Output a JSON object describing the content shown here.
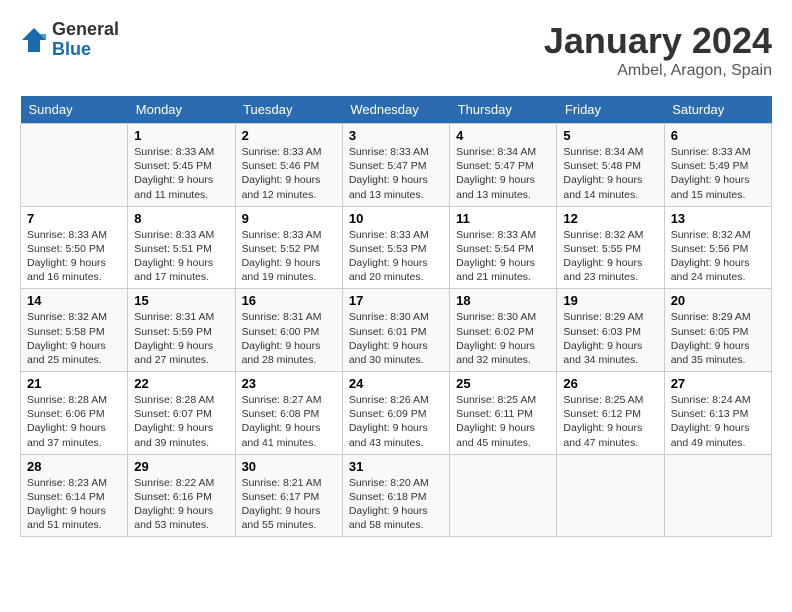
{
  "logo": {
    "general": "General",
    "blue": "Blue"
  },
  "title": "January 2024",
  "location": "Ambel, Aragon, Spain",
  "headers": [
    "Sunday",
    "Monday",
    "Tuesday",
    "Wednesday",
    "Thursday",
    "Friday",
    "Saturday"
  ],
  "weeks": [
    [
      {
        "day": "",
        "sunrise": "",
        "sunset": "",
        "daylight": ""
      },
      {
        "day": "1",
        "sunrise": "Sunrise: 8:33 AM",
        "sunset": "Sunset: 5:45 PM",
        "daylight": "Daylight: 9 hours and 11 minutes."
      },
      {
        "day": "2",
        "sunrise": "Sunrise: 8:33 AM",
        "sunset": "Sunset: 5:46 PM",
        "daylight": "Daylight: 9 hours and 12 minutes."
      },
      {
        "day": "3",
        "sunrise": "Sunrise: 8:33 AM",
        "sunset": "Sunset: 5:47 PM",
        "daylight": "Daylight: 9 hours and 13 minutes."
      },
      {
        "day": "4",
        "sunrise": "Sunrise: 8:34 AM",
        "sunset": "Sunset: 5:47 PM",
        "daylight": "Daylight: 9 hours and 13 minutes."
      },
      {
        "day": "5",
        "sunrise": "Sunrise: 8:34 AM",
        "sunset": "Sunset: 5:48 PM",
        "daylight": "Daylight: 9 hours and 14 minutes."
      },
      {
        "day": "6",
        "sunrise": "Sunrise: 8:33 AM",
        "sunset": "Sunset: 5:49 PM",
        "daylight": "Daylight: 9 hours and 15 minutes."
      }
    ],
    [
      {
        "day": "7",
        "sunrise": "Sunrise: 8:33 AM",
        "sunset": "Sunset: 5:50 PM",
        "daylight": "Daylight: 9 hours and 16 minutes."
      },
      {
        "day": "8",
        "sunrise": "Sunrise: 8:33 AM",
        "sunset": "Sunset: 5:51 PM",
        "daylight": "Daylight: 9 hours and 17 minutes."
      },
      {
        "day": "9",
        "sunrise": "Sunrise: 8:33 AM",
        "sunset": "Sunset: 5:52 PM",
        "daylight": "Daylight: 9 hours and 19 minutes."
      },
      {
        "day": "10",
        "sunrise": "Sunrise: 8:33 AM",
        "sunset": "Sunset: 5:53 PM",
        "daylight": "Daylight: 9 hours and 20 minutes."
      },
      {
        "day": "11",
        "sunrise": "Sunrise: 8:33 AM",
        "sunset": "Sunset: 5:54 PM",
        "daylight": "Daylight: 9 hours and 21 minutes."
      },
      {
        "day": "12",
        "sunrise": "Sunrise: 8:32 AM",
        "sunset": "Sunset: 5:55 PM",
        "daylight": "Daylight: 9 hours and 23 minutes."
      },
      {
        "day": "13",
        "sunrise": "Sunrise: 8:32 AM",
        "sunset": "Sunset: 5:56 PM",
        "daylight": "Daylight: 9 hours and 24 minutes."
      }
    ],
    [
      {
        "day": "14",
        "sunrise": "Sunrise: 8:32 AM",
        "sunset": "Sunset: 5:58 PM",
        "daylight": "Daylight: 9 hours and 25 minutes."
      },
      {
        "day": "15",
        "sunrise": "Sunrise: 8:31 AM",
        "sunset": "Sunset: 5:59 PM",
        "daylight": "Daylight: 9 hours and 27 minutes."
      },
      {
        "day": "16",
        "sunrise": "Sunrise: 8:31 AM",
        "sunset": "Sunset: 6:00 PM",
        "daylight": "Daylight: 9 hours and 28 minutes."
      },
      {
        "day": "17",
        "sunrise": "Sunrise: 8:30 AM",
        "sunset": "Sunset: 6:01 PM",
        "daylight": "Daylight: 9 hours and 30 minutes."
      },
      {
        "day": "18",
        "sunrise": "Sunrise: 8:30 AM",
        "sunset": "Sunset: 6:02 PM",
        "daylight": "Daylight: 9 hours and 32 minutes."
      },
      {
        "day": "19",
        "sunrise": "Sunrise: 8:29 AM",
        "sunset": "Sunset: 6:03 PM",
        "daylight": "Daylight: 9 hours and 34 minutes."
      },
      {
        "day": "20",
        "sunrise": "Sunrise: 8:29 AM",
        "sunset": "Sunset: 6:05 PM",
        "daylight": "Daylight: 9 hours and 35 minutes."
      }
    ],
    [
      {
        "day": "21",
        "sunrise": "Sunrise: 8:28 AM",
        "sunset": "Sunset: 6:06 PM",
        "daylight": "Daylight: 9 hours and 37 minutes."
      },
      {
        "day": "22",
        "sunrise": "Sunrise: 8:28 AM",
        "sunset": "Sunset: 6:07 PM",
        "daylight": "Daylight: 9 hours and 39 minutes."
      },
      {
        "day": "23",
        "sunrise": "Sunrise: 8:27 AM",
        "sunset": "Sunset: 6:08 PM",
        "daylight": "Daylight: 9 hours and 41 minutes."
      },
      {
        "day": "24",
        "sunrise": "Sunrise: 8:26 AM",
        "sunset": "Sunset: 6:09 PM",
        "daylight": "Daylight: 9 hours and 43 minutes."
      },
      {
        "day": "25",
        "sunrise": "Sunrise: 8:25 AM",
        "sunset": "Sunset: 6:11 PM",
        "daylight": "Daylight: 9 hours and 45 minutes."
      },
      {
        "day": "26",
        "sunrise": "Sunrise: 8:25 AM",
        "sunset": "Sunset: 6:12 PM",
        "daylight": "Daylight: 9 hours and 47 minutes."
      },
      {
        "day": "27",
        "sunrise": "Sunrise: 8:24 AM",
        "sunset": "Sunset: 6:13 PM",
        "daylight": "Daylight: 9 hours and 49 minutes."
      }
    ],
    [
      {
        "day": "28",
        "sunrise": "Sunrise: 8:23 AM",
        "sunset": "Sunset: 6:14 PM",
        "daylight": "Daylight: 9 hours and 51 minutes."
      },
      {
        "day": "29",
        "sunrise": "Sunrise: 8:22 AM",
        "sunset": "Sunset: 6:16 PM",
        "daylight": "Daylight: 9 hours and 53 minutes."
      },
      {
        "day": "30",
        "sunrise": "Sunrise: 8:21 AM",
        "sunset": "Sunset: 6:17 PM",
        "daylight": "Daylight: 9 hours and 55 minutes."
      },
      {
        "day": "31",
        "sunrise": "Sunrise: 8:20 AM",
        "sunset": "Sunset: 6:18 PM",
        "daylight": "Daylight: 9 hours and 58 minutes."
      },
      {
        "day": "",
        "sunrise": "",
        "sunset": "",
        "daylight": ""
      },
      {
        "day": "",
        "sunrise": "",
        "sunset": "",
        "daylight": ""
      },
      {
        "day": "",
        "sunrise": "",
        "sunset": "",
        "daylight": ""
      }
    ]
  ]
}
